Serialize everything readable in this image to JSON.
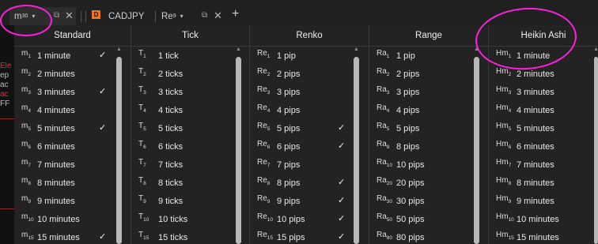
{
  "tabs": [
    {
      "name": "m",
      "sub": "30",
      "caret": "▾",
      "popout": "⧉",
      "close": "✕"
    },
    {
      "badge": "D",
      "label": "CADJPY"
    },
    {
      "name": "Re",
      "sub": "9",
      "caret": "▾",
      "popout": "⧉",
      "close": "✕"
    }
  ],
  "plus": "+",
  "chart_fragments": [
    "Ele",
    "ep",
    "ac",
    "ac",
    "FF"
  ],
  "check": "✓",
  "scroll_up": "▲",
  "columns": [
    {
      "title": "Standard",
      "items": [
        {
          "sym": "m",
          "sub": "1",
          "label": "1 minute",
          "checked": true
        },
        {
          "sym": "m",
          "sub": "2",
          "label": "2 minutes",
          "checked": false
        },
        {
          "sym": "m",
          "sub": "3",
          "label": "3 minutes",
          "checked": true
        },
        {
          "sym": "m",
          "sub": "4",
          "label": "4 minutes",
          "checked": false
        },
        {
          "sym": "m",
          "sub": "5",
          "label": "5 minutes",
          "checked": true
        },
        {
          "sym": "m",
          "sub": "6",
          "label": "6 minutes",
          "checked": false
        },
        {
          "sym": "m",
          "sub": "7",
          "label": "7 minutes",
          "checked": false
        },
        {
          "sym": "m",
          "sub": "8",
          "label": "8 minutes",
          "checked": false
        },
        {
          "sym": "m",
          "sub": "9",
          "label": "9 minutes",
          "checked": false
        },
        {
          "sym": "m",
          "sub": "10",
          "label": "10 minutes",
          "checked": false
        },
        {
          "sym": "m",
          "sub": "15",
          "label": "15 minutes",
          "checked": true
        }
      ]
    },
    {
      "title": "Tick",
      "items": [
        {
          "sym": "T",
          "sub": "1",
          "label": "1 tick",
          "checked": false
        },
        {
          "sym": "T",
          "sub": "2",
          "label": "2 ticks",
          "checked": false
        },
        {
          "sym": "T",
          "sub": "3",
          "label": "3 ticks",
          "checked": false
        },
        {
          "sym": "T",
          "sub": "4",
          "label": "4 ticks",
          "checked": false
        },
        {
          "sym": "T",
          "sub": "5",
          "label": "5 ticks",
          "checked": false
        },
        {
          "sym": "T",
          "sub": "6",
          "label": "6 ticks",
          "checked": false
        },
        {
          "sym": "T",
          "sub": "7",
          "label": "7 ticks",
          "checked": false
        },
        {
          "sym": "T",
          "sub": "8",
          "label": "8 ticks",
          "checked": false
        },
        {
          "sym": "T",
          "sub": "9",
          "label": "9 ticks",
          "checked": false
        },
        {
          "sym": "T",
          "sub": "10",
          "label": "10 ticks",
          "checked": false
        },
        {
          "sym": "T",
          "sub": "15",
          "label": "15 ticks",
          "checked": false
        }
      ]
    },
    {
      "title": "Renko",
      "items": [
        {
          "sym": "Re",
          "sub": "1",
          "label": "1 pip",
          "checked": false
        },
        {
          "sym": "Re",
          "sub": "2",
          "label": "2 pips",
          "checked": false
        },
        {
          "sym": "Re",
          "sub": "3",
          "label": "3 pips",
          "checked": false
        },
        {
          "sym": "Re",
          "sub": "4",
          "label": "4 pips",
          "checked": false
        },
        {
          "sym": "Re",
          "sub": "5",
          "label": "5 pips",
          "checked": true
        },
        {
          "sym": "Re",
          "sub": "6",
          "label": "6 pips",
          "checked": true
        },
        {
          "sym": "Re",
          "sub": "7",
          "label": "7 pips",
          "checked": false
        },
        {
          "sym": "Re",
          "sub": "8",
          "label": "8 pips",
          "checked": true
        },
        {
          "sym": "Re",
          "sub": "9",
          "label": "9 pips",
          "checked": true
        },
        {
          "sym": "Re",
          "sub": "10",
          "label": "10 pips",
          "checked": true
        },
        {
          "sym": "Re",
          "sub": "15",
          "label": "15 pips",
          "checked": true
        }
      ]
    },
    {
      "title": "Range",
      "items": [
        {
          "sym": "Ra",
          "sub": "1",
          "label": "1 pip",
          "checked": false
        },
        {
          "sym": "Ra",
          "sub": "2",
          "label": "2 pips",
          "checked": false
        },
        {
          "sym": "Ra",
          "sub": "3",
          "label": "3 pips",
          "checked": false
        },
        {
          "sym": "Ra",
          "sub": "4",
          "label": "4 pips",
          "checked": false
        },
        {
          "sym": "Ra",
          "sub": "5",
          "label": "5 pips",
          "checked": false
        },
        {
          "sym": "Ra",
          "sub": "8",
          "label": "8 pips",
          "checked": false
        },
        {
          "sym": "Ra",
          "sub": "10",
          "label": "10 pips",
          "checked": false
        },
        {
          "sym": "Ra",
          "sub": "20",
          "label": "20 pips",
          "checked": false
        },
        {
          "sym": "Ra",
          "sub": "30",
          "label": "30 pips",
          "checked": false
        },
        {
          "sym": "Ra",
          "sub": "50",
          "label": "50 pips",
          "checked": false
        },
        {
          "sym": "Ra",
          "sub": "80",
          "label": "80 pips",
          "checked": false
        }
      ]
    },
    {
      "title": "Heikin Ashi",
      "items": [
        {
          "sym": "Hm",
          "sub": "1",
          "label": "1 minute",
          "checked": false
        },
        {
          "sym": "Hm",
          "sub": "2",
          "label": "2 minutes",
          "checked": false
        },
        {
          "sym": "Hm",
          "sub": "3",
          "label": "3 minutes",
          "checked": false
        },
        {
          "sym": "Hm",
          "sub": "4",
          "label": "4 minutes",
          "checked": false
        },
        {
          "sym": "Hm",
          "sub": "5",
          "label": "5 minutes",
          "checked": false
        },
        {
          "sym": "Hm",
          "sub": "6",
          "label": "6 minutes",
          "checked": false
        },
        {
          "sym": "Hm",
          "sub": "7",
          "label": "7 minutes",
          "checked": false
        },
        {
          "sym": "Hm",
          "sub": "8",
          "label": "8 minutes",
          "checked": false
        },
        {
          "sym": "Hm",
          "sub": "9",
          "label": "9 minutes",
          "checked": false
        },
        {
          "sym": "Hm",
          "sub": "10",
          "label": "10 minutes",
          "checked": false
        },
        {
          "sym": "Hm",
          "sub": "15",
          "label": "15 minutes",
          "checked": false
        }
      ]
    }
  ],
  "colors": {
    "background": "#1a1a1a",
    "dropdown": "#232323",
    "badge": "#e8761e",
    "annotation": "#ff1fde",
    "scrollbar": "#b8b8b8"
  }
}
